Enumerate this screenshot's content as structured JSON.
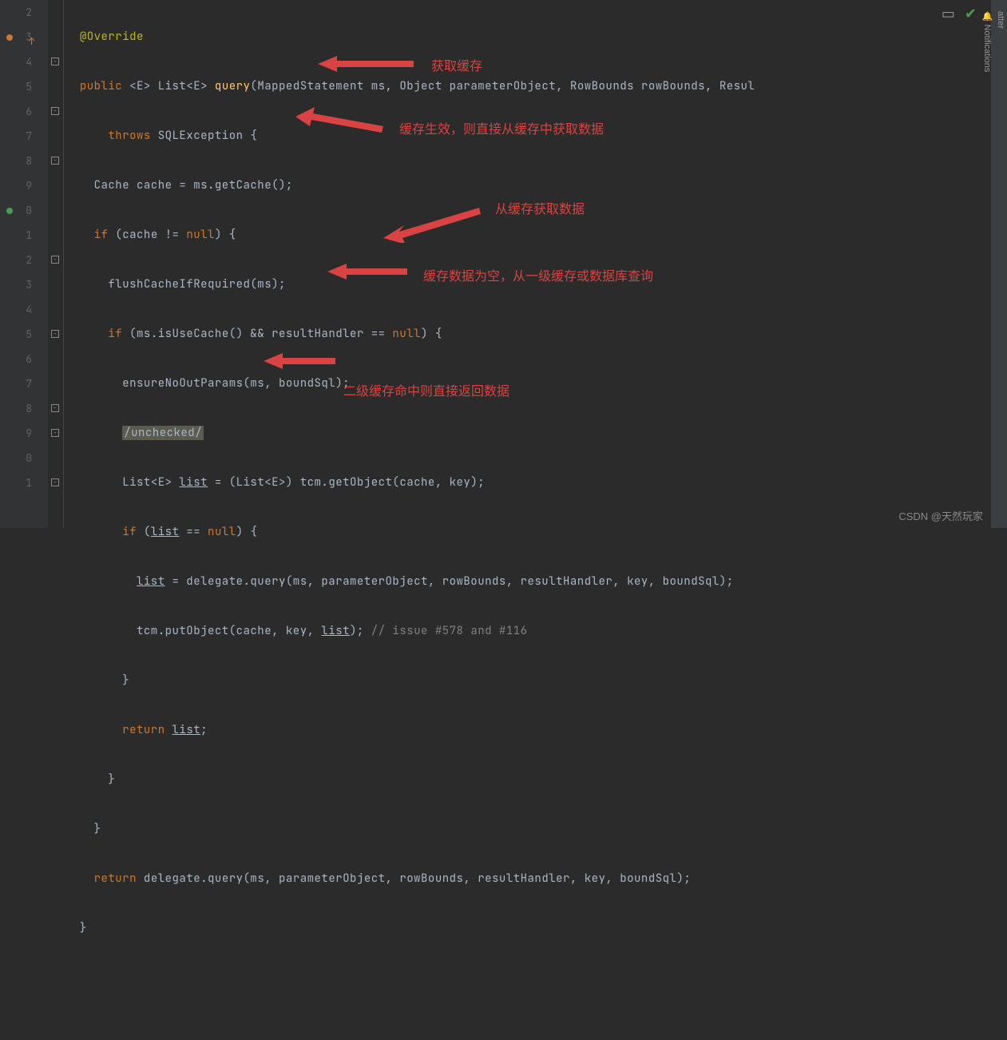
{
  "gutter": {
    "start": 2,
    "lines": [
      "2",
      "3",
      "4",
      "5",
      "6",
      "7",
      "8",
      "9",
      "0",
      "1",
      "2",
      "3",
      "4",
      "5",
      "6",
      "7",
      "8",
      "9",
      "0",
      "1"
    ]
  },
  "code": {
    "l1": "@Override",
    "l2_pub": "public",
    "l2_gen": " <E> List<E> ",
    "l2_fn": "query",
    "l2_args": "(MappedStatement ms, Object parameterObject, RowBounds rowBounds, Resul",
    "l3_throws": "throws",
    "l3_rest": " SQLException {",
    "l4": "Cache cache = ms.getCache();",
    "l5_if": "if",
    "l5_cond": " (cache != ",
    "l5_null": "null",
    "l5_end": ") {",
    "l6": "flushCacheIfRequired(ms);",
    "l7_if": "if",
    "l7_cond": " (ms.isUseCache() && resultHandler == ",
    "l7_null": "null",
    "l7_end": ") {",
    "l8": "ensureNoOutParams(ms, boundSql);",
    "l9": "/unchecked/",
    "l10a": "List<E> ",
    "l10_list": "list",
    "l10b": " = (List<E>) tcm.getObject(cache, key);",
    "l11_if": "if",
    "l11a": " (",
    "l11_list": "list",
    "l11b": " == ",
    "l11_null": "null",
    "l11_end": ") {",
    "l12_list": "list",
    "l12": " = delegate.query(ms, parameterObject, rowBounds, resultHandler, key, boundSql);",
    "l13a": "tcm.putObject(cache, key, ",
    "l13_list": "list",
    "l13b": "); ",
    "l13_com": "// issue #578 and #116",
    "l14": "}",
    "l15_ret": "return",
    "l15_sp": " ",
    "l15_list": "list",
    "l15_end": ";",
    "l16": "}",
    "l17": "}",
    "l18_ret": "return",
    "l18": " delegate.query(ms, parameterObject, rowBounds, resultHandler, key, boundSql);",
    "l19": "}"
  },
  "annotations": {
    "a1": "获取缓存",
    "a2": "缓存生效，则直接从缓存中获取数据",
    "a3": "从缓存获取数据",
    "a4": "缓存数据为空，从一级缓存或数据库查询",
    "a5": "二级缓存命中则直接返回数据"
  },
  "rightbar": {
    "t1": "atter",
    "t2": "Notifications"
  },
  "watermark": "CSDN @天然玩家"
}
